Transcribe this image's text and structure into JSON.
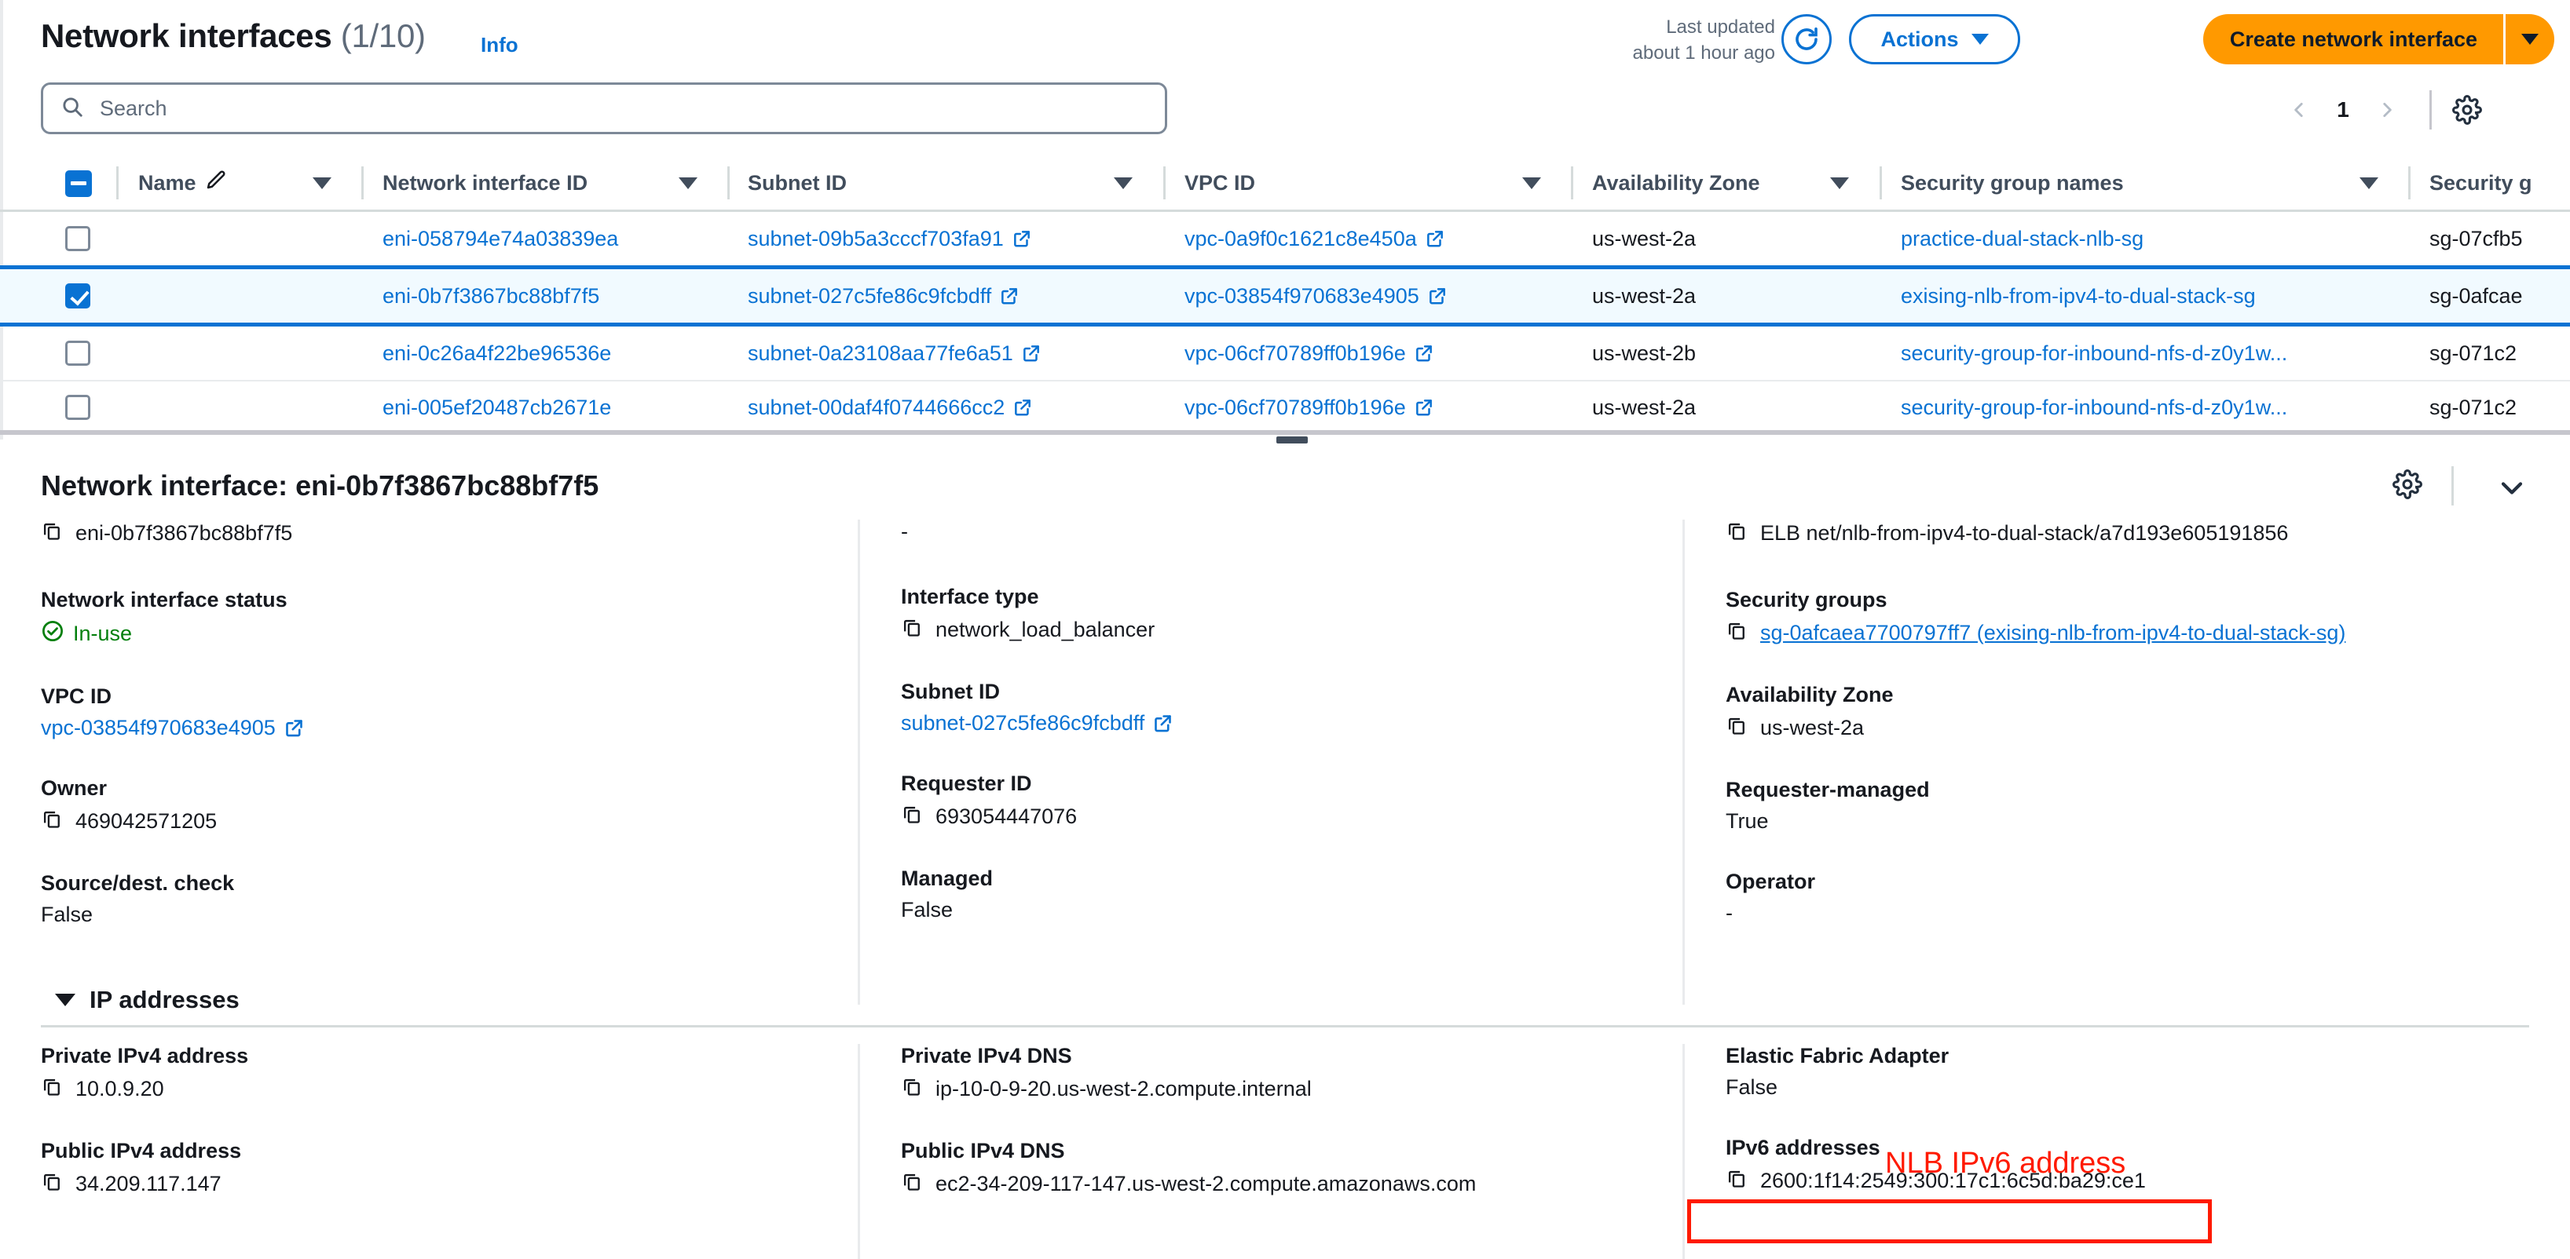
{
  "header": {
    "title": "Network interfaces",
    "count": "(1/10)",
    "info_link": "Info",
    "last_updated_line1": "Last updated",
    "last_updated_line2": "about 1 hour ago",
    "refresh_icon": "refresh-icon",
    "actions_label": "Actions",
    "create_label": "Create network interface"
  },
  "search": {
    "placeholder": "Search",
    "icon": "search-icon"
  },
  "pagination": {
    "prev": "‹",
    "page": "1",
    "next": "›",
    "settings_icon": "gear-icon"
  },
  "table": {
    "columns": [
      "Name",
      "Network interface ID",
      "Subnet ID",
      "VPC ID",
      "Availability Zone",
      "Security group names",
      "Security g"
    ],
    "rows": [
      {
        "selected": false,
        "name": "",
        "eni": "eni-058794e74a03839ea",
        "subnet": "subnet-09b5a3cccf703fa91",
        "vpc": "vpc-0a9f0c1621c8e450a",
        "az": "us-west-2a",
        "sg_names": "practice-dual-stack-nlb-sg",
        "sg_ids": "sg-07cfb5"
      },
      {
        "selected": true,
        "name": "",
        "eni": "eni-0b7f3867bc88bf7f5",
        "subnet": "subnet-027c5fe86c9fcbdff",
        "vpc": "vpc-03854f970683e4905",
        "az": "us-west-2a",
        "sg_names": "exising-nlb-from-ipv4-to-dual-stack-sg",
        "sg_ids": "sg-0afcae"
      },
      {
        "selected": false,
        "name": "",
        "eni": "eni-0c26a4f22be96536e",
        "subnet": "subnet-0a23108aa77fe6a51",
        "vpc": "vpc-06cf70789ff0b196e",
        "az": "us-west-2b",
        "sg_names": "security-group-for-inbound-nfs-d-z0y1w...",
        "sg_ids": "sg-071c2"
      },
      {
        "selected": false,
        "name": "",
        "eni": "eni-005ef20487cb2671e",
        "subnet": "subnet-00daf4f0744666cc2",
        "vpc": "vpc-06cf70789ff0b196e",
        "az": "us-west-2a",
        "sg_names": "security-group-for-inbound-nfs-d-z0y1w...",
        "sg_ids": "sg-071c2"
      }
    ]
  },
  "detail": {
    "title": "Network interface: eni-0b7f3867bc88bf7f5",
    "col1": {
      "id_value": "eni-0b7f3867bc88bf7f5",
      "status_label": "Network interface status",
      "status_value": "In-use",
      "vpc_label": "VPC ID",
      "vpc_value": "vpc-03854f970683e4905",
      "owner_label": "Owner",
      "owner_value": "469042571205",
      "srcdest_label": "Source/dest. check",
      "srcdest_value": "False"
    },
    "col2": {
      "top_value": "-",
      "iftype_label": "Interface type",
      "iftype_value": "network_load_balancer",
      "subnet_label": "Subnet ID",
      "subnet_value": "subnet-027c5fe86c9fcbdff",
      "requester_label": "Requester ID",
      "requester_value": "693054447076",
      "managed_label": "Managed",
      "managed_value": "False"
    },
    "col3": {
      "top_value": "ELB net/nlb-from-ipv4-to-dual-stack/a7d193e605191856",
      "sg_label": "Security groups",
      "sg_value": "sg-0afcaea7700797ff7 (exising-nlb-from-ipv4-to-dual-stack-sg)",
      "az_label": "Availability Zone",
      "az_value": "us-west-2a",
      "reqmanaged_label": "Requester-managed",
      "reqmanaged_value": "True",
      "operator_label": "Operator",
      "operator_value": "-"
    }
  },
  "ip_section": {
    "heading": "IP addresses",
    "col1": {
      "priv4_label": "Private IPv4 address",
      "priv4_value": "10.0.9.20",
      "pub4_label": "Public IPv4 address",
      "pub4_value": "34.209.117.147"
    },
    "col2": {
      "priv4dns_label": "Private IPv4 DNS",
      "priv4dns_value": "ip-10-0-9-20.us-west-2.compute.internal",
      "pub4dns_label": "Public IPv4 DNS",
      "pub4dns_value": "ec2-34-209-117-147.us-west-2.compute.amazonaws.com"
    },
    "col3": {
      "efa_label": "Elastic Fabric Adapter",
      "efa_value": "False",
      "ipv6_label": "IPv6 addresses",
      "ipv6_value": "2600:1f14:2549:300:17c1:6c5d:ba29:ce1"
    }
  },
  "annotation": {
    "text": "NLB IPv6 address",
    "color": "#ff1a00"
  },
  "colors": {
    "link": "#0972d3",
    "accent_orange": "#ff9900",
    "status_green": "#037f0c",
    "selected_row_bg": "#f1faff"
  }
}
